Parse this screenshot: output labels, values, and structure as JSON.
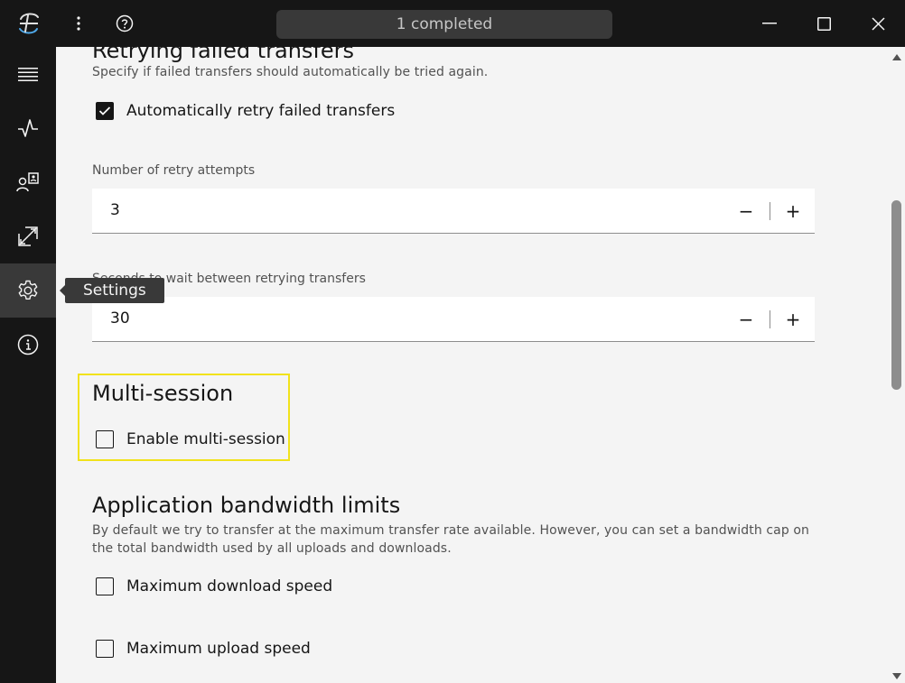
{
  "titlebar": {
    "status_text": "1 completed",
    "icons": [
      "app-logo-icon",
      "kebab-menu-icon",
      "help-icon",
      "minimize-icon",
      "maximize-icon",
      "close-icon"
    ]
  },
  "rail": {
    "items": [
      {
        "name": "menu",
        "icon": "hamburger-menu-icon"
      },
      {
        "name": "activity",
        "icon": "activity-icon"
      },
      {
        "name": "connections",
        "icon": "user-contacts-icon"
      },
      {
        "name": "transfers",
        "icon": "transfer-icon"
      },
      {
        "name": "settings",
        "icon": "gear-icon",
        "active": true
      },
      {
        "name": "about",
        "icon": "info-icon"
      }
    ]
  },
  "tooltip": {
    "text": "Settings"
  },
  "retry": {
    "title": "Retrying failed transfers",
    "description": "Specify if failed transfers should automatically be tried again.",
    "auto_retry": {
      "label": "Automatically retry failed transfers",
      "checked": true
    },
    "attempts": {
      "label": "Number of retry attempts",
      "value": "3"
    },
    "wait": {
      "label": "Seconds to wait between retrying transfers",
      "value": "30"
    }
  },
  "stepper": {
    "decrement": "−",
    "increment": "+"
  },
  "multisession": {
    "title": "Multi-session",
    "enable": {
      "label": "Enable multi-session",
      "checked": false
    }
  },
  "bandwidth": {
    "title": "Application bandwidth limits",
    "description": "By default we try to transfer at the maximum transfer rate available. However, you can set a bandwidth cap on the total bandwidth used by all uploads and downloads.",
    "download": {
      "label": "Maximum download speed",
      "checked": false
    },
    "upload": {
      "label": "Maximum upload speed",
      "checked": false
    }
  },
  "colors": {
    "chrome": "#161616",
    "background": "#f4f4f4",
    "highlight": "#f1e21b",
    "pill": "#393939"
  }
}
